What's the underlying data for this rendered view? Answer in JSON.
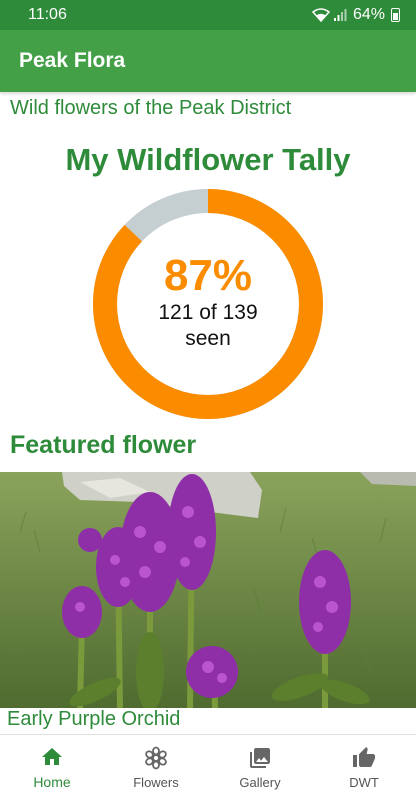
{
  "status": {
    "time": "11:06",
    "battery": "64%"
  },
  "app": {
    "title": "Peak Flora"
  },
  "subtitle": "Wild flowers of the Peak District",
  "tally": {
    "title": "My Wildflower Tally",
    "percent_label": "87%",
    "seen_count_label": "121 of 139",
    "seen_word": "seen",
    "seen": 121,
    "total": 139,
    "colors": {
      "progress": "#fb8c00",
      "remaining": "#c5ced1"
    }
  },
  "featured": {
    "heading": "Featured flower",
    "name": "Early Purple Orchid"
  },
  "nav": {
    "items": [
      {
        "label": "Home",
        "icon": "home-icon",
        "active": true
      },
      {
        "label": "Flowers",
        "icon": "flower-icon",
        "active": false
      },
      {
        "label": "Gallery",
        "icon": "gallery-icon",
        "active": false
      },
      {
        "label": "DWT",
        "icon": "thumbs-up-icon",
        "active": false
      }
    ]
  },
  "colors": {
    "primary": "#43a047",
    "primary_dark": "#2e8b3a",
    "accent": "#fb8c00"
  }
}
